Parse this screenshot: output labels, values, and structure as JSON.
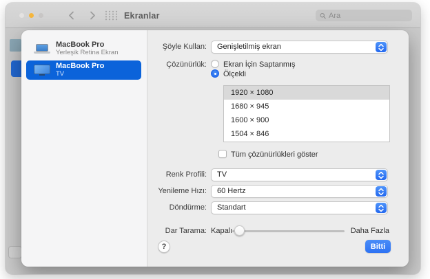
{
  "toolbar": {
    "title": "Ekranlar",
    "search_placeholder": "Ara"
  },
  "sidebar": {
    "items": [
      {
        "title": "MacBook Pro",
        "subtitle": "Yerleşik Retina Ekran",
        "selected": false
      },
      {
        "title": "MacBook Pro",
        "subtitle": "TV",
        "selected": true
      }
    ]
  },
  "form": {
    "use_as": {
      "label": "Şöyle Kullan:",
      "value": "Genişletilmiş ekran"
    },
    "resolution": {
      "label": "Çözünürlük:",
      "options": [
        {
          "label": "Ekran İçin Saptanmış",
          "selected": false
        },
        {
          "label": "Ölçekli",
          "selected": true
        }
      ]
    },
    "resolution_list": {
      "items": [
        "1920 × 1080",
        "1680 × 945",
        "1600 × 900",
        "1504 × 846"
      ],
      "selected_index": 0
    },
    "show_all": {
      "label": "Tüm çözünürlükleri göster",
      "checked": false
    },
    "color_profile": {
      "label": "Renk Profili:",
      "value": "TV"
    },
    "refresh_rate": {
      "label": "Yenileme Hızı:",
      "value": "60 Hertz"
    },
    "rotation": {
      "label": "Döndürme:",
      "value": "Standart"
    },
    "underscan": {
      "label": "Dar Tarama:",
      "min_label": "Kapalı",
      "max_label": "Daha Fazla",
      "value": "Kapalı"
    }
  },
  "footer": {
    "help_label": "?",
    "done_label": "Bitti"
  },
  "colors": {
    "selection_blue": "#0b63da",
    "control_blue": "#2d72f3",
    "traffic_amber": "#f5b63d",
    "dialog_form_bg": "#ececec",
    "dialog_sidebar_bg": "#f5f5f6",
    "window_chrome": "#d4d4d4"
  }
}
